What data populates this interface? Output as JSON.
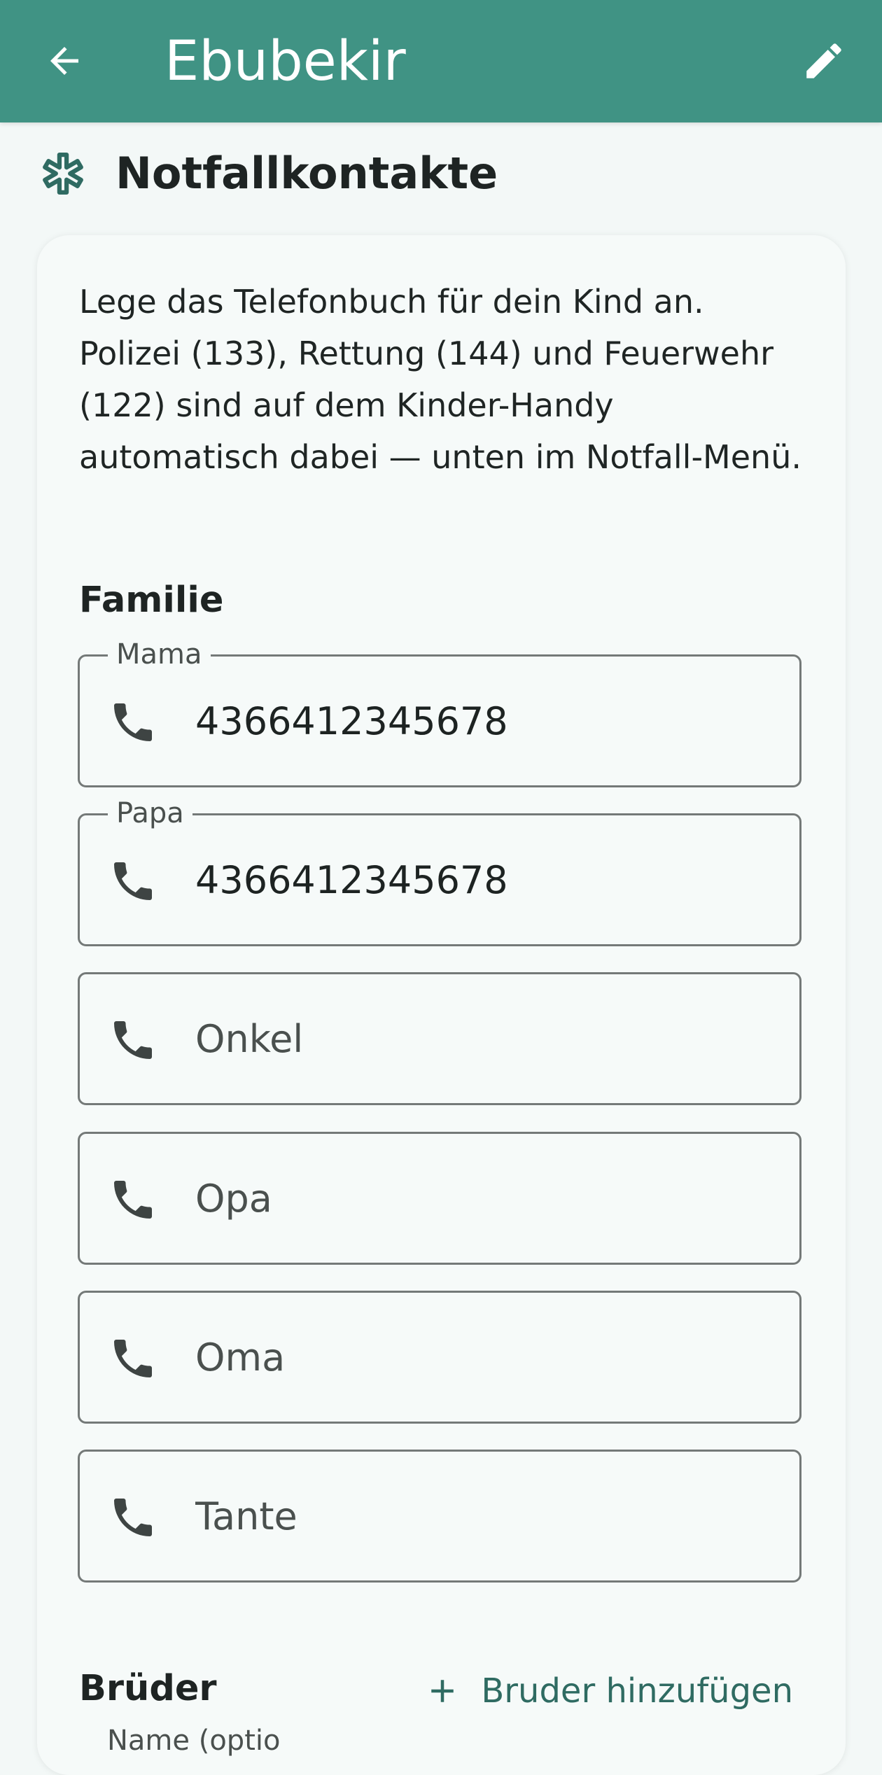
{
  "appbar": {
    "title": "Ebubekir",
    "back_icon": "arrow-back-icon",
    "edit_icon": "pencil-icon",
    "color": "#409384"
  },
  "section": {
    "title": "Notfallkontakte",
    "icon": "medical-asterisk-icon"
  },
  "intro": "Lege das Telefonbuch für dein Kind an. Polizei (133), Rettung (144) und Feuerwehr (122) sind auf dem Kinder-Handy automatisch dabei — unten im Notfall-Menü.",
  "family": {
    "title": "Familie",
    "fields": [
      {
        "label": "Mama",
        "value": "4366412345678",
        "placeholder": ""
      },
      {
        "label": "Papa",
        "value": "4366412345678",
        "placeholder": ""
      },
      {
        "label": "",
        "value": "",
        "placeholder": "Onkel"
      },
      {
        "label": "",
        "value": "",
        "placeholder": "Opa"
      },
      {
        "label": "",
        "value": "",
        "placeholder": "Oma"
      },
      {
        "label": "",
        "value": "",
        "placeholder": "Tante"
      }
    ]
  },
  "brothers": {
    "title": "Brüder",
    "add_label": "Bruder hinzufügen",
    "partial_label": "Name (optio"
  },
  "colors": {
    "accent": "#409384",
    "accent_dark": "#2F6B62",
    "icon": "#3E4443",
    "background": "#F3F8F7"
  }
}
